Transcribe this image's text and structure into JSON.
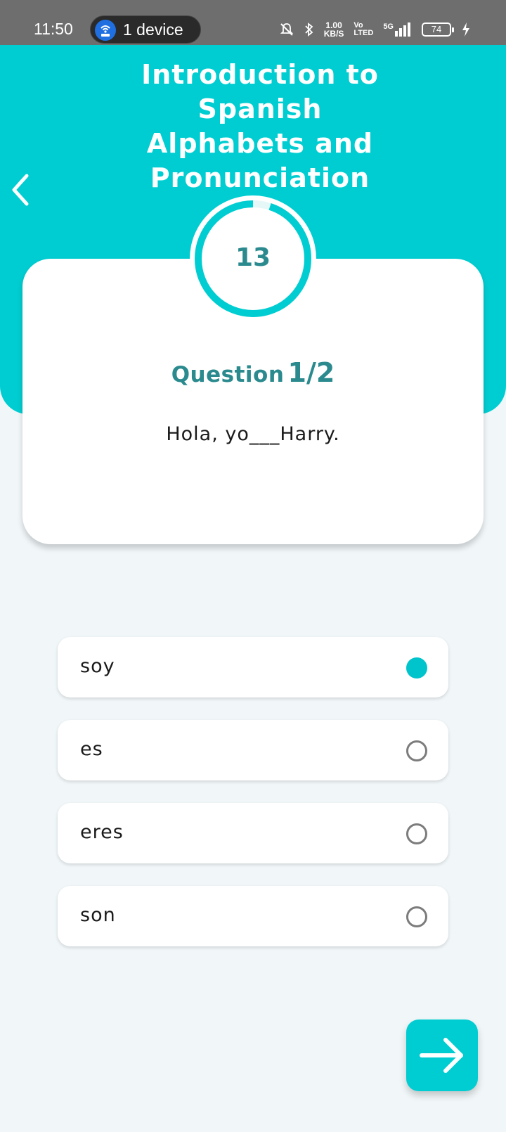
{
  "status_bar": {
    "time": "11:50",
    "device_pill": "1 device",
    "net_speed_value": "1.00",
    "net_speed_unit": "KB/S",
    "volte_top": "Vo",
    "volte_bottom": "LTED",
    "network": "5G",
    "battery": "74"
  },
  "header": {
    "title": "Introduction to Spanish Alphabets and Pronunciation"
  },
  "timer": {
    "value": "13",
    "progress": 0.95
  },
  "question": {
    "label": "Question",
    "number": "1/2",
    "text": "Hola, yo___Harry."
  },
  "options": [
    {
      "label": "soy",
      "selected": true
    },
    {
      "label": "es",
      "selected": false
    },
    {
      "label": "eres",
      "selected": false
    },
    {
      "label": "son",
      "selected": false
    }
  ],
  "colors": {
    "accent": "#00cdd1",
    "text_teal": "#2a8a8e",
    "background": "#f1f7f9"
  }
}
